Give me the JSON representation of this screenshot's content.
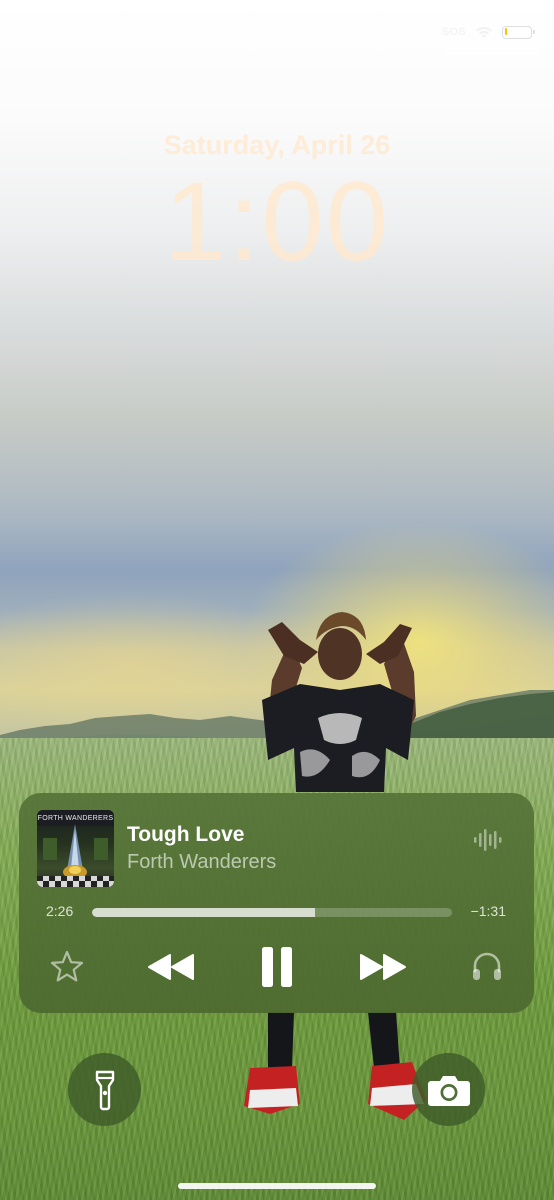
{
  "status_bar": {
    "carrier_text": "SOS",
    "battery_level": 0.12,
    "battery_color": "#f5c400",
    "wifi_icon": "wifi-icon",
    "battery_icon": "battery-icon"
  },
  "lock_screen": {
    "date": "Saturday, April 26",
    "time": "1:00",
    "text_color": "#ffe8cd"
  },
  "now_playing": {
    "album_art_text": "FORTH WANDERERS",
    "title": "Tough Love",
    "artist": "Forth Wanderers",
    "elapsed": "2:26",
    "remaining": "−1:31",
    "progress": 0.62,
    "background_color": "#56743a",
    "icons": [
      "audio-wave-icon",
      "star-icon",
      "rewind-icon",
      "pause-icon",
      "forward-icon",
      "airpods-icon"
    ]
  },
  "quick_actions": {
    "left_icon": "flashlight-icon",
    "right_icon": "camera-icon"
  }
}
